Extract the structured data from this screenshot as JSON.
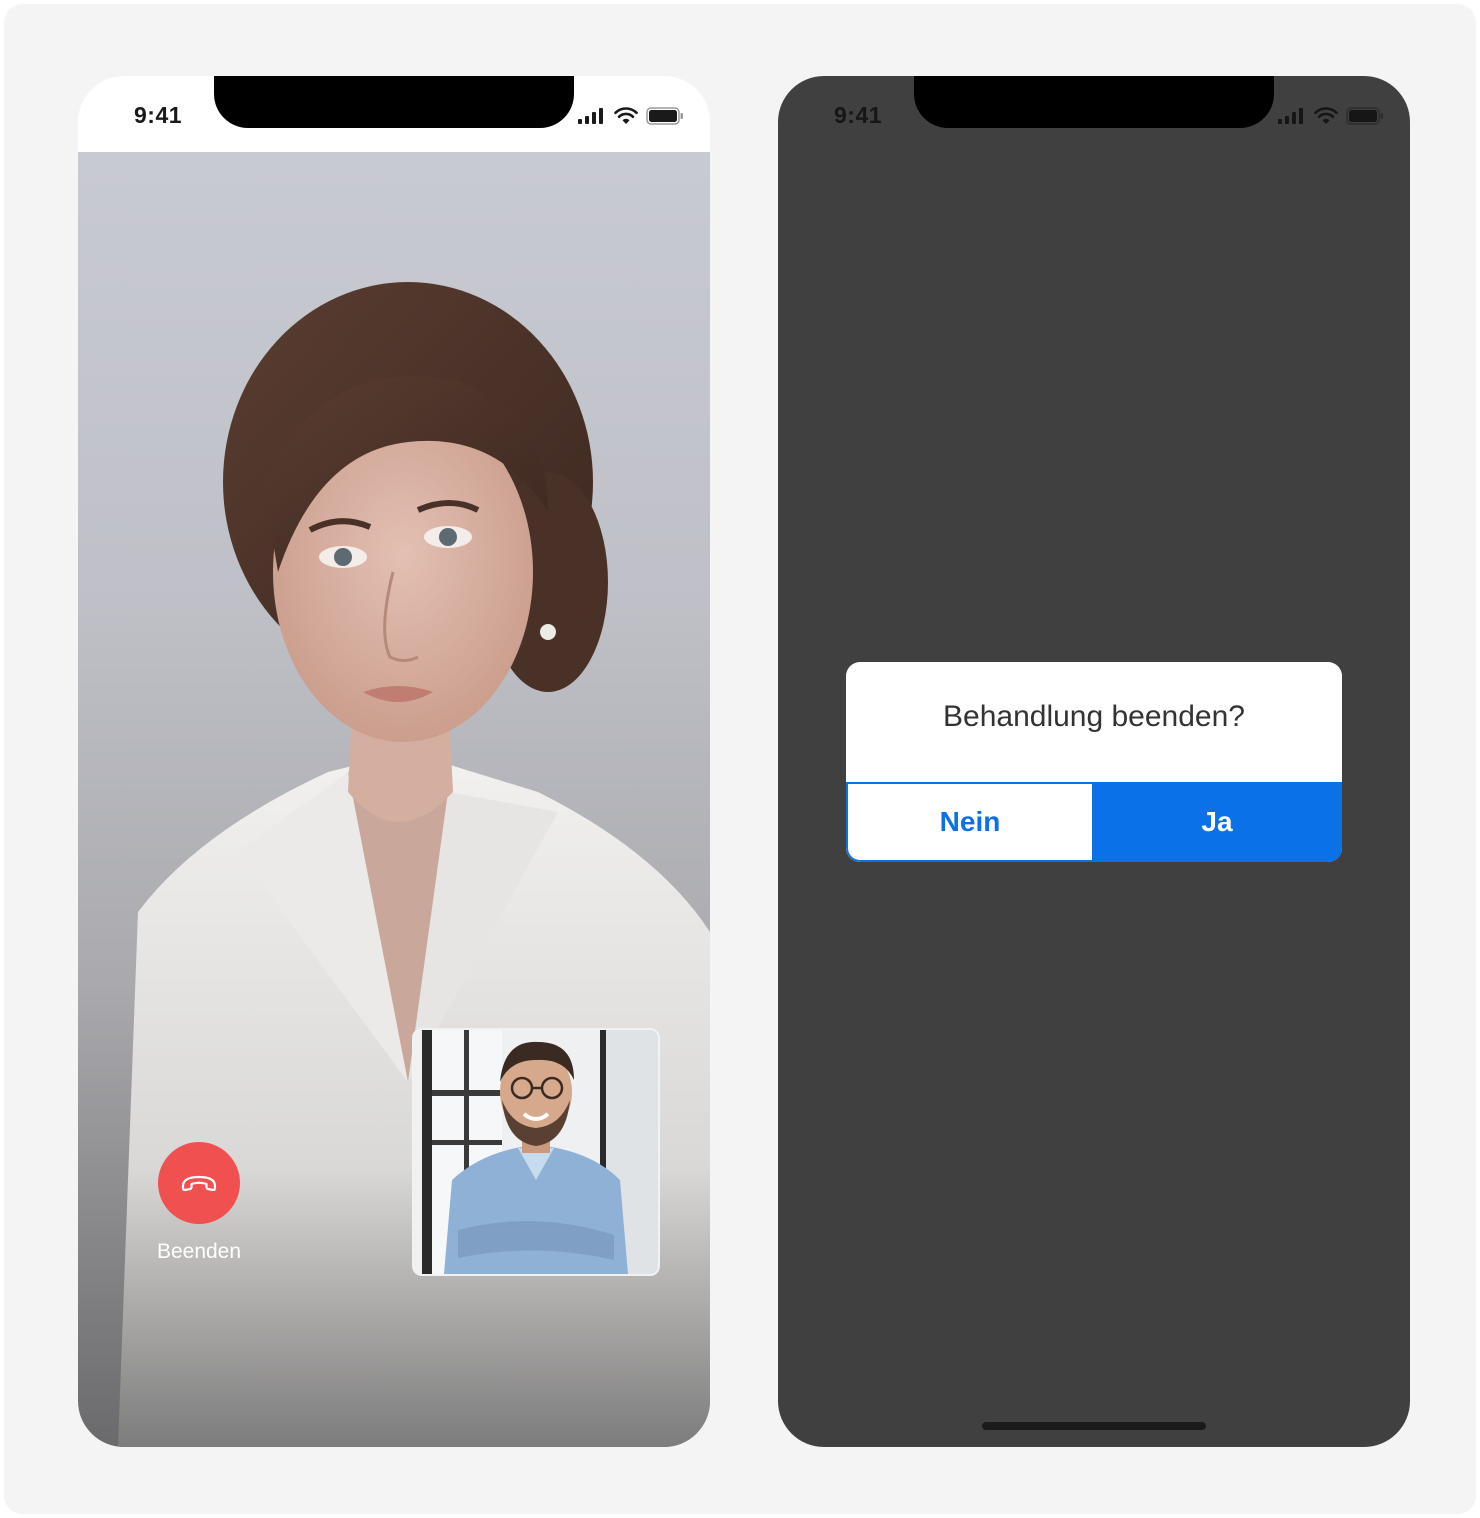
{
  "left_phone": {
    "status": {
      "time": "9:41"
    },
    "end_call": {
      "label": "Beenden",
      "icon": "phone-hangup-icon",
      "color": "#f0504f"
    }
  },
  "right_phone": {
    "status": {
      "time": "9:41"
    },
    "dialog": {
      "title": "Behandlung beenden?",
      "no_label": "Nein",
      "yes_label": "Ja",
      "accent_color": "#0a72e6"
    }
  }
}
